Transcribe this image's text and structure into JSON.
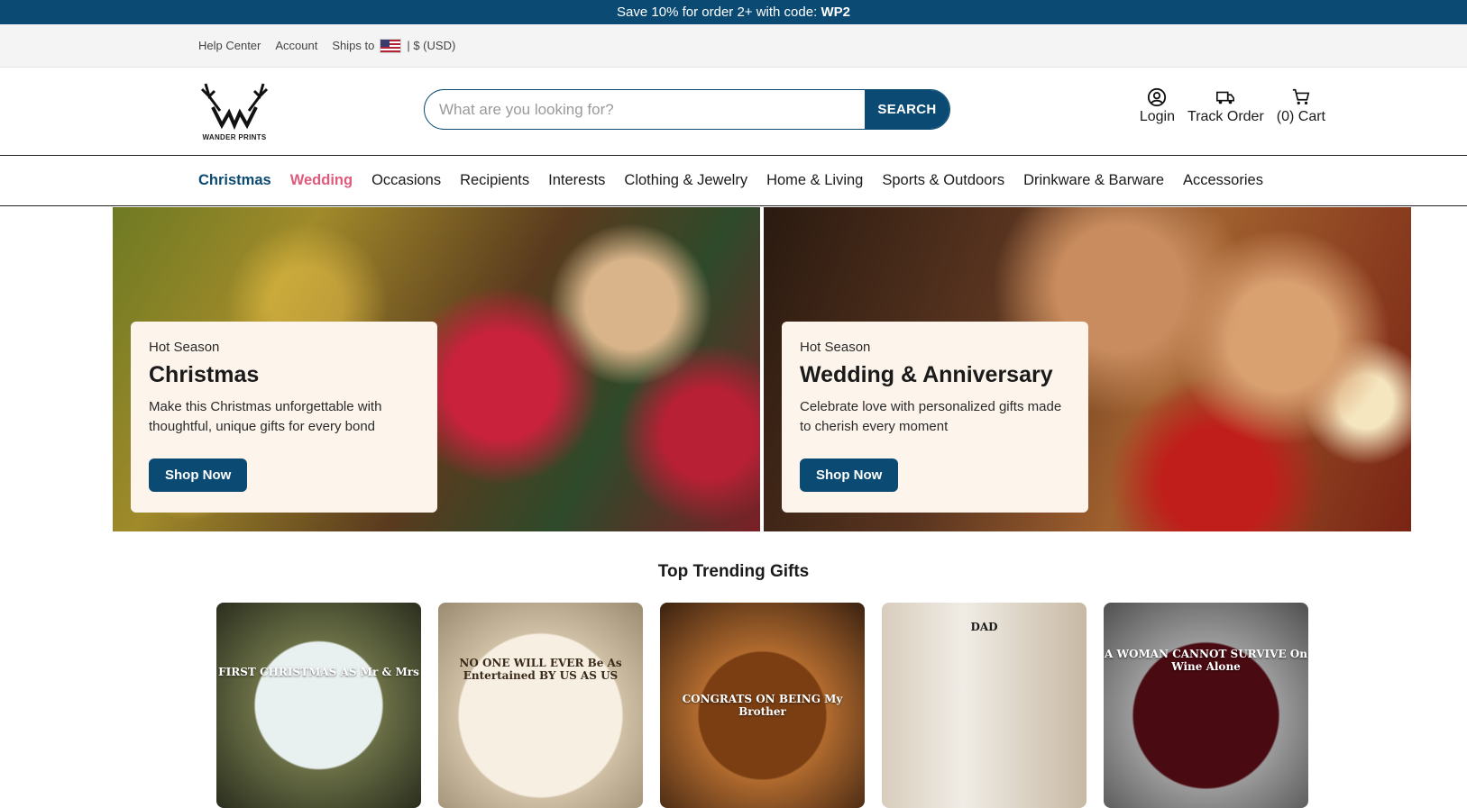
{
  "promo": {
    "text": "Save 10% for order 2+ with code: ",
    "code": "WP2"
  },
  "utility": {
    "help": "Help Center",
    "account": "Account",
    "ships_label": "Ships to",
    "currency": "| $ (USD)"
  },
  "header": {
    "logo_text": "WANDER PRINTS",
    "search_placeholder": "What are you looking for?",
    "search_button": "SEARCH",
    "login": "Login",
    "track": "Track Order",
    "cart": "(0) Cart"
  },
  "nav": [
    "Christmas",
    "Wedding",
    "Occasions",
    "Recipients",
    "Interests",
    "Clothing & Jewelry",
    "Home & Living",
    "Sports & Outdoors",
    "Drinkware & Barware",
    "Accessories"
  ],
  "banners": [
    {
      "eyebrow": "Hot Season",
      "title": "Christmas",
      "desc": "Make this Christmas unforgettable with thoughtful, unique gifts for every bond",
      "button": "Shop Now"
    },
    {
      "eyebrow": "Hot Season",
      "title": "Wedding & Anniversary",
      "desc": "Celebrate love with personalized gifts made to cherish every moment",
      "button": "Shop Now"
    }
  ],
  "trending_title": "Top Trending Gifts",
  "products": [
    {
      "caption": "FIRST CHRISTMAS AS Mr & Mrs"
    },
    {
      "caption": "NO ONE WILL EVER Be As Entertained BY US AS US"
    },
    {
      "caption": "CONGRATS ON BEING My Brother"
    },
    {
      "caption": "DAD"
    },
    {
      "caption": "A WOMAN CANNOT SURVIVE On Wine Alone"
    }
  ],
  "colors": {
    "brand": "#0b4a73",
    "accent_pink": "#e05a7c",
    "card_bg": "#fdf5ec"
  }
}
